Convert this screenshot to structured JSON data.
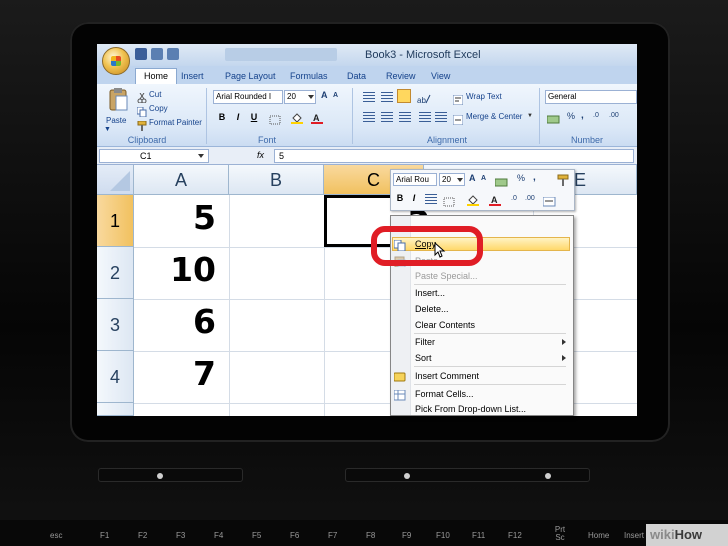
{
  "window": {
    "title": "Book3 - Microsoft Excel"
  },
  "ribbon": {
    "tabs": [
      "Home",
      "Insert",
      "Page Layout",
      "Formulas",
      "Data",
      "Review",
      "View"
    ],
    "clipboard": {
      "paste": "Paste",
      "cut": "Cut",
      "copy": "Copy",
      "format_painter": "Format Painter",
      "label": "Clipboard"
    },
    "font": {
      "name": "Arial Rounded I",
      "size": "20",
      "label": "Font",
      "bold": "B",
      "italic": "I",
      "underline": "U"
    },
    "alignment": {
      "wrap_text": "Wrap Text",
      "merge_center": "Merge & Center",
      "label": "Alignment"
    },
    "number": {
      "format": "General",
      "label": "Number"
    }
  },
  "formula_bar": {
    "name_box": "C1",
    "fx": "fx",
    "value": "5"
  },
  "grid": {
    "columns": [
      "A",
      "B",
      "C",
      "E"
    ],
    "rows": [
      "1",
      "2",
      "3",
      "4"
    ],
    "values": [
      "5",
      "10",
      "6",
      "7"
    ],
    "c1_value": "5"
  },
  "mini_toolbar": {
    "font": "Arial Rou",
    "size": "20",
    "bold": "B",
    "italic": "I",
    "percent": "%",
    "comma": ","
  },
  "context_menu": {
    "items": {
      "copy": "Copy",
      "paste": "Paste",
      "paste_special": "Paste Special...",
      "insert": "Insert...",
      "delete": "Delete...",
      "clear_contents": "Clear Contents",
      "filter": "Filter",
      "sort": "Sort",
      "insert_comment": "Insert Comment",
      "format_cells": "Format Cells...",
      "pick_list": "Pick From Drop-down List..."
    }
  },
  "keyboard": {
    "keys": [
      "esc",
      "F1",
      "F2",
      "F3",
      "F4",
      "F5",
      "F6",
      "F7",
      "F8",
      "F9",
      "F10",
      "F11",
      "F12",
      "Prt Sc",
      "Home",
      "Insert"
    ]
  },
  "watermark": {
    "wiki": "wiki",
    "how": "How"
  },
  "colors": {
    "selection_accent": "#f1c15f",
    "highlight_ring": "#e01d25",
    "ribbon_text": "#15428b"
  }
}
